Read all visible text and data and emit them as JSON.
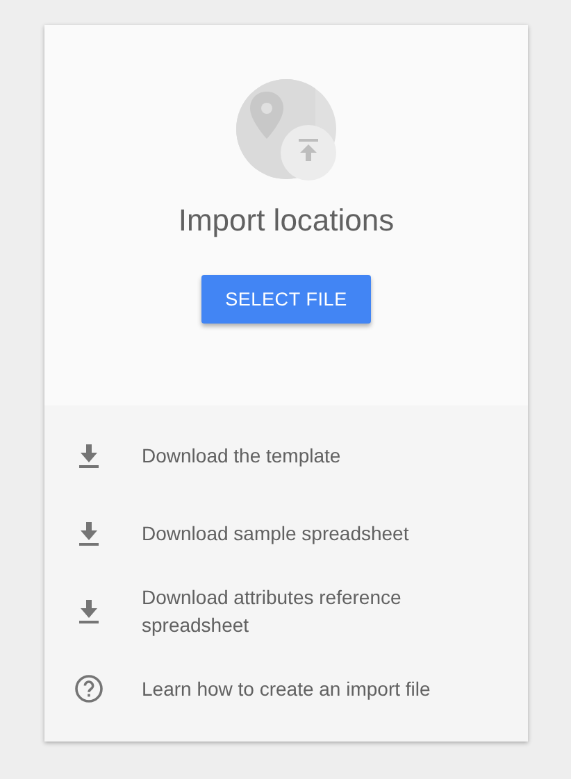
{
  "title": "Import locations",
  "button": "SELECT FILE",
  "links": [
    {
      "kind": "download",
      "label": "Download the template"
    },
    {
      "kind": "download",
      "label": "Download sample spreadsheet"
    },
    {
      "kind": "download",
      "label": "Download attributes reference spreadsheet"
    },
    {
      "kind": "help",
      "label": "Learn how to create an import file"
    }
  ]
}
